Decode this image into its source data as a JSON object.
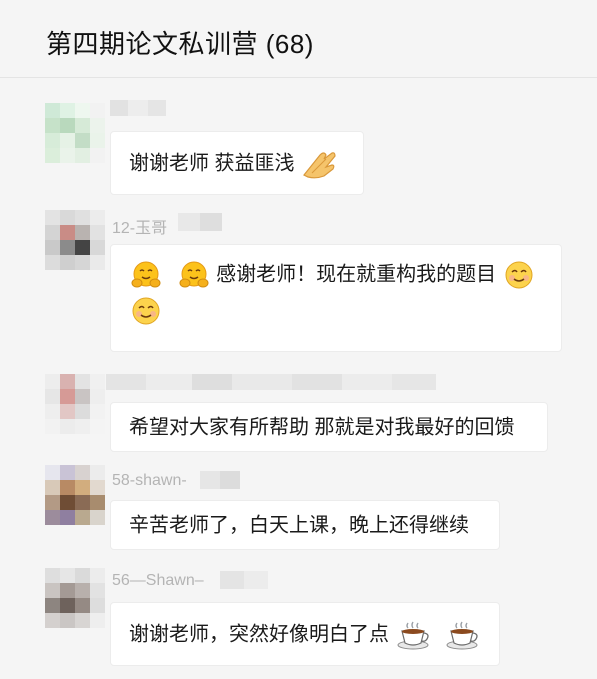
{
  "chat": {
    "title": "第四期论文私训营 (68)"
  },
  "messages": [
    {
      "sender": "",
      "parts": [
        "谢谢老师  获益匪浅"
      ],
      "emoji_after": [
        "clap-icon"
      ]
    },
    {
      "sender": "12-玉哥",
      "line1": "感谢老师！现在就重构我的题目",
      "emoji": [
        "hug-icon",
        "hug-icon",
        "smile-icon",
        "smile-icon"
      ]
    },
    {
      "sender": "",
      "text": "希望对大家有所帮助 那就是对我最好的回馈"
    },
    {
      "sender": "58-shawn-",
      "text": "辛苦老师了，白天上课，晚上还得继续"
    },
    {
      "sender": "56—Shawn–",
      "text": "谢谢老师，突然好像明白了点",
      "emoji": [
        "coffee-icon",
        "coffee-icon"
      ]
    }
  ]
}
